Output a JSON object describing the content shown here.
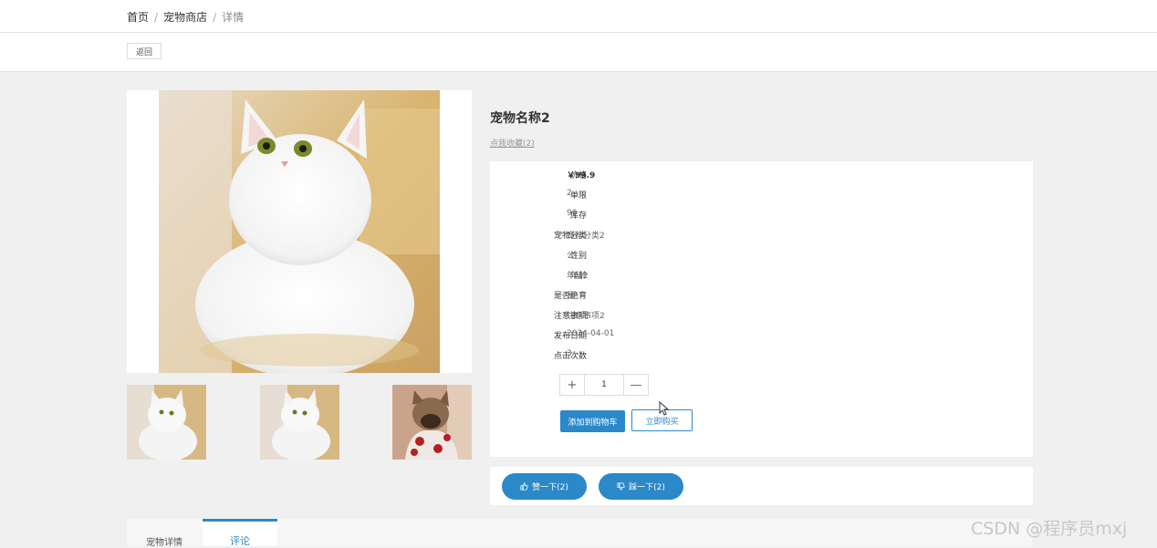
{
  "breadcrumb": {
    "home": "首页",
    "shop": "宠物商店",
    "current": "详情",
    "sep": "/"
  },
  "back_label": "返回",
  "pet": {
    "name": "宠物名称2",
    "favorite_label": "点我收藏(2)"
  },
  "info": [
    {
      "label": "价格",
      "value": "￥99.9"
    },
    {
      "label": "单限",
      "value": "2"
    },
    {
      "label": "库存",
      "value": "99"
    },
    {
      "label": "宠物分类",
      "value": "宠物分类2"
    },
    {
      "label": "性别",
      "value": "公"
    },
    {
      "label": "年龄",
      "value": "年龄2"
    },
    {
      "label": "是否绝育",
      "value": "是"
    },
    {
      "label": "注意事项",
      "value": "注意事项2"
    },
    {
      "label": "发布日期",
      "value": "2024-04-01"
    },
    {
      "label": "点击次数",
      "value": "3"
    }
  ],
  "stepper": {
    "plus": "+",
    "quantity": "1",
    "minus": "—"
  },
  "actions": {
    "add_to_cart": "添加到购物车",
    "buy_now": "立即购买"
  },
  "votes": {
    "like": "赞一下(2)",
    "dislike": "踩一下(2)"
  },
  "tabs": {
    "detail": "宠物详情",
    "comment": "评论"
  },
  "watermark": "CSDN @程序员mxj",
  "colors": {
    "accent": "#2b88c9",
    "background": "#f0f0f0"
  }
}
